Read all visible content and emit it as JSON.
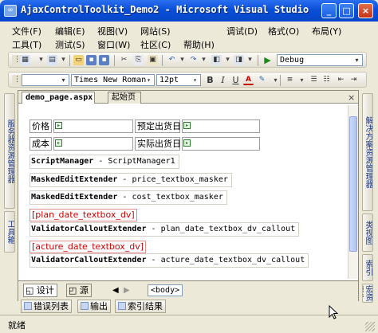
{
  "window": {
    "title": "AjaxControlToolkit_Demo2 - Microsoft Visual Studio"
  },
  "menu": {
    "row1": [
      "文件(F)",
      "编辑(E)",
      "视图(V)",
      "网站(S)",
      "调试(D)",
      "格式(O)",
      "布局(Y)"
    ],
    "row2": [
      "工具(T)",
      "测试(S)",
      "窗口(W)",
      "社区(C)",
      "帮助(H)"
    ]
  },
  "toolbar": {
    "solution_config": "Debug",
    "font_name": "Times New Roman",
    "font_size": "12pt",
    "bold": "B",
    "italic": "I",
    "underline": "U",
    "font_color": "A"
  },
  "left_sidebar": {
    "server_explorer": "服务器资源管理器",
    "toolbox": "工具箱"
  },
  "right_sidebar": {
    "solution_explorer": "解决方案资源管理器",
    "class_view": "类视图",
    "index": "索引",
    "macro_explorer": "宏资源管"
  },
  "document": {
    "tabs": [
      "demo_page.aspx",
      "起始页"
    ],
    "close": "×",
    "table": {
      "row1": {
        "label1": "价格",
        "label2": "预定出货日"
      },
      "row2": {
        "label1": "成本",
        "label2": "实际出货日"
      }
    },
    "controls": [
      {
        "kind": "ScriptManager",
        "id": "ScriptManager1"
      },
      {
        "kind": "MaskedEditExtender",
        "id": "price_textbox_masker"
      },
      {
        "kind": "MaskedEditExtender",
        "id": "cost_textbox_masker"
      },
      {
        "kind": "ValidatorCalloutExtender",
        "id": "plan_date_textbox_dv_callout"
      },
      {
        "kind": "ValidatorCalloutExtender",
        "id": "acture_date_textbox_dv_callout"
      }
    ],
    "validators": [
      "[plan_date_textbox_dv]",
      "[acture_date_textbox_dv]"
    ],
    "dash": "-"
  },
  "view_tabs": {
    "design": "设计",
    "source": "源",
    "tag": "<body>"
  },
  "output_tabs": [
    "错误列表",
    "输出",
    "索引结果"
  ],
  "status": {
    "text": "就绪"
  }
}
